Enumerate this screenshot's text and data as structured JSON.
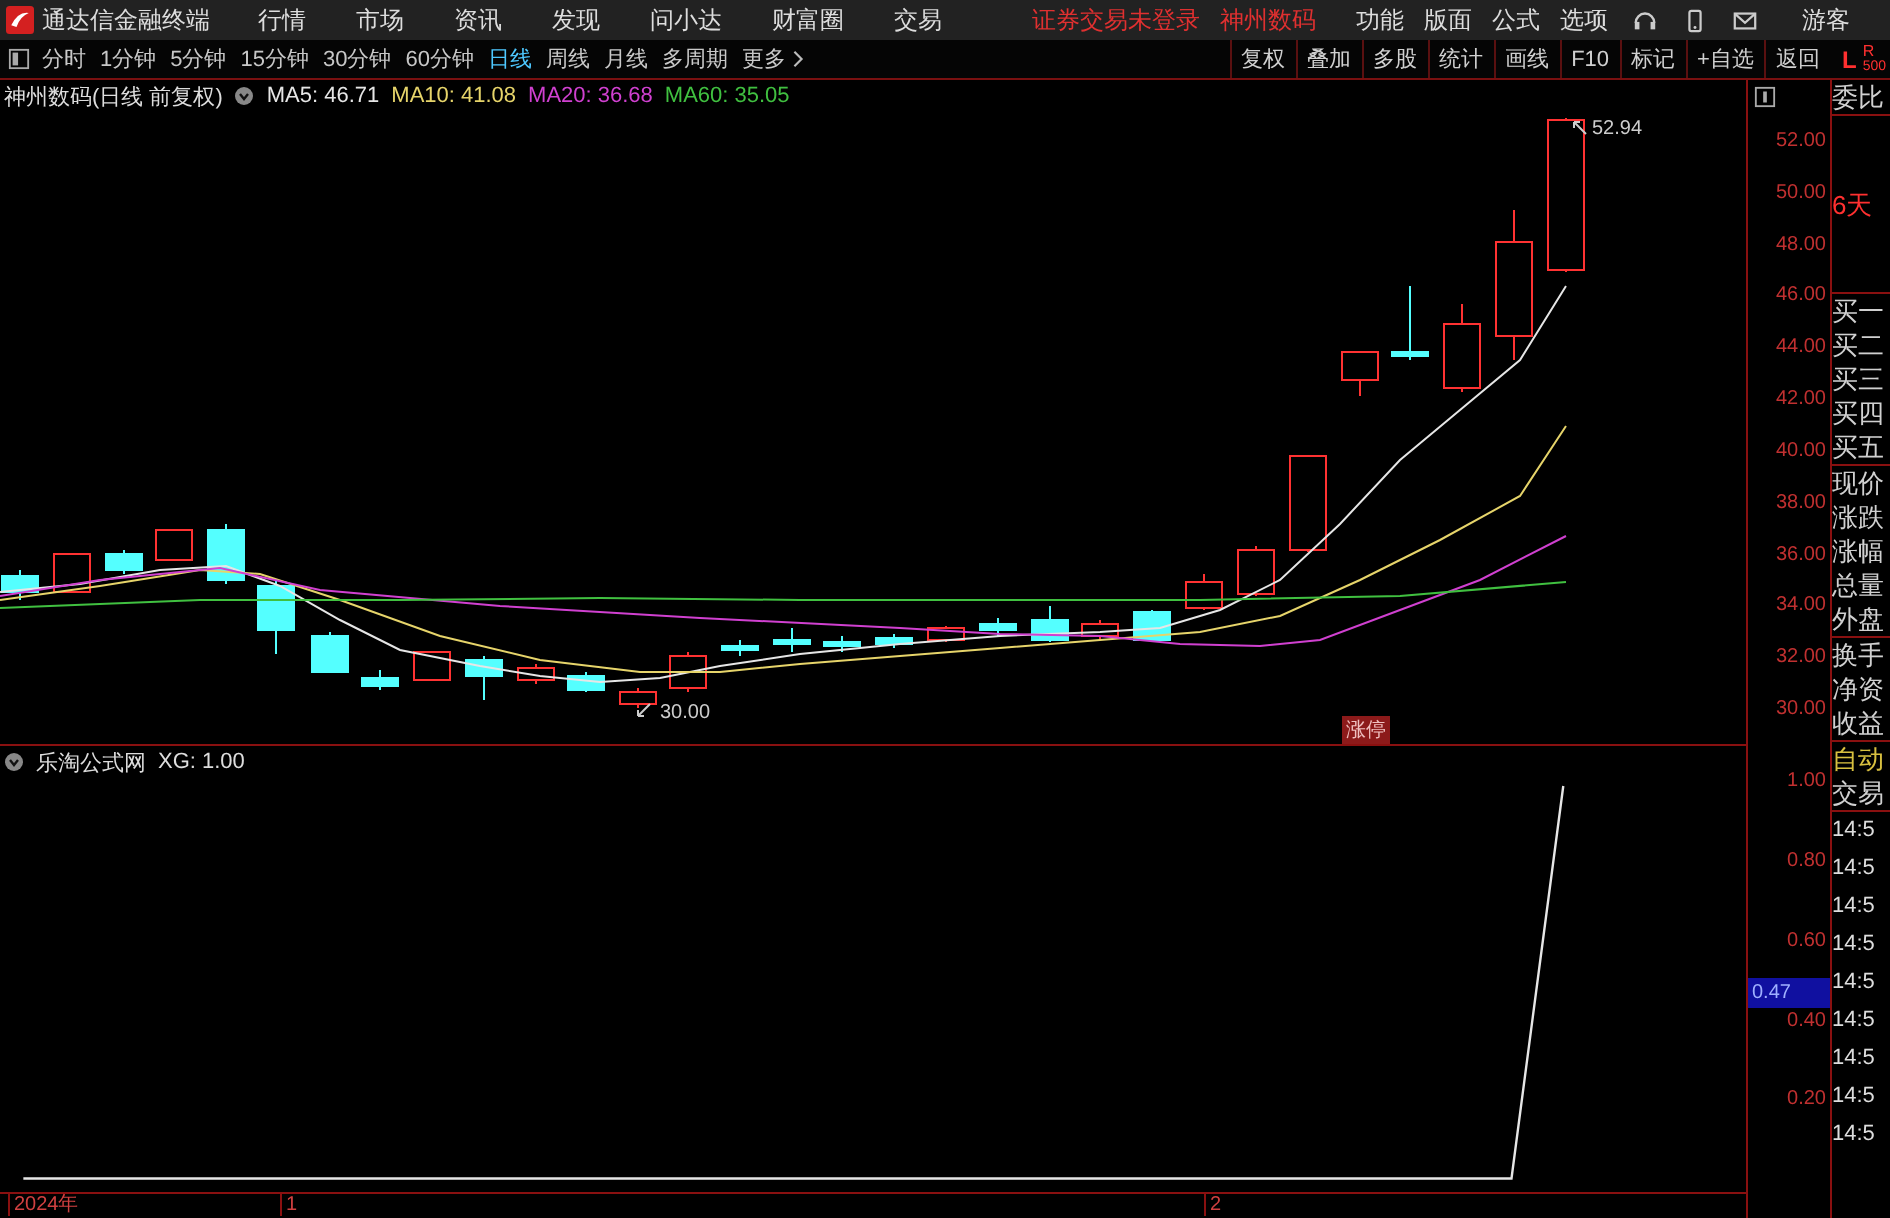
{
  "menu_bar": {
    "app_title": "通达信金融终端",
    "menus": [
      "行情",
      "市场",
      "资讯",
      "发现",
      "问小达",
      "财富圈",
      "交易"
    ],
    "notices": [
      "证券交易未登录",
      "神州数码"
    ],
    "tools": [
      "功能",
      "版面",
      "公式",
      "选项"
    ],
    "user": "游客"
  },
  "toolbar": {
    "periods": [
      {
        "label": "分时",
        "selected": false
      },
      {
        "label": "1分钟",
        "selected": false
      },
      {
        "label": "5分钟",
        "selected": false
      },
      {
        "label": "15分钟",
        "selected": false
      },
      {
        "label": "30分钟",
        "selected": false
      },
      {
        "label": "60分钟",
        "selected": false
      },
      {
        "label": "日线",
        "selected": true
      },
      {
        "label": "周线",
        "selected": false
      },
      {
        "label": "月线",
        "selected": false
      },
      {
        "label": "多周期",
        "selected": false
      },
      {
        "label": "更多",
        "selected": false
      }
    ],
    "actions": [
      "复权",
      "叠加",
      "多股",
      "统计",
      "画线",
      "F10",
      "标记",
      "+自选",
      "返回"
    ],
    "corner_left": "L",
    "corner_right": "R",
    "corner_count": "500"
  },
  "price_panel": {
    "title": "神州数码(日线 前复权)",
    "indicators": [
      {
        "label": "MA5: 46.71",
        "color": "#e6e6e6"
      },
      {
        "label": "MA10: 41.08",
        "color": "#e6d46a"
      },
      {
        "label": "MA20: 36.68",
        "color": "#d040d0"
      },
      {
        "label": "MA60: 35.05",
        "color": "#40c040"
      }
    ],
    "yticks": [
      "52.00",
      "50.00",
      "48.00",
      "46.00",
      "44.00",
      "42.00",
      "40.00",
      "38.00",
      "36.00",
      "34.00",
      "32.00",
      "30.00"
    ],
    "high_label": "52.94",
    "low_label": "30.00",
    "limit_tag": "涨停"
  },
  "indicator_panel": {
    "title": "乐淘公式网",
    "reading": "XG: 1.00",
    "yticks": [
      "1.00",
      "0.80",
      "0.60",
      "0.40",
      "0.20"
    ],
    "cursor_value": "0.47"
  },
  "x_axis": [
    "2024年",
    "1",
    "2"
  ],
  "quote_panel": {
    "ratio_label": "委比",
    "days": "6天",
    "bids": [
      "买一",
      "买二",
      "买三",
      "买四",
      "买五"
    ],
    "fields": [
      "现价",
      "涨跌",
      "涨幅",
      "总量",
      "外盘"
    ],
    "fields2": [
      "换手",
      "净资",
      "收益"
    ],
    "mode": "自动",
    "trades_label": "交易",
    "trade_times": [
      "14:5",
      "14:5",
      "14:5",
      "14:5",
      "14:5",
      "14:5",
      "14:5",
      "14:5",
      "14:5"
    ]
  }
}
